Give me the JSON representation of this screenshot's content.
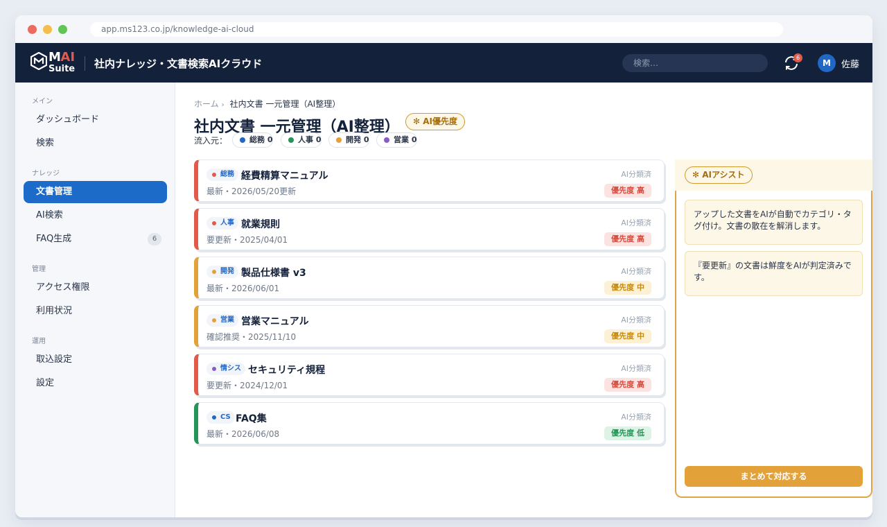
{
  "browser": {
    "url": "app.ms123.co.jp/knowledge-ai-cloud"
  },
  "header": {
    "logo_m": "M",
    "logo_ai": "AI",
    "logo_suite": "Suite",
    "title": "社内ナレッジ・文書検索AIクラウド",
    "search_placeholder": "検索…",
    "notification_count": "6",
    "avatar_initial": "M",
    "user_name": "佐藤"
  },
  "sidebar": {
    "groups": [
      {
        "label": "メイン",
        "items": [
          {
            "label": "ダッシュボード"
          },
          {
            "label": "検索"
          }
        ]
      },
      {
        "label": "ナレッジ",
        "items": [
          {
            "label": "文書管理",
            "active": true
          },
          {
            "label": "AI検索"
          },
          {
            "label": "FAQ生成",
            "count": "6"
          }
        ]
      },
      {
        "label": "管理",
        "items": [
          {
            "label": "アクセス権限"
          },
          {
            "label": "利用状況"
          }
        ]
      },
      {
        "label": "運用",
        "items": [
          {
            "label": "取込設定"
          },
          {
            "label": "設定"
          }
        ]
      }
    ]
  },
  "breadcrumb": {
    "home": "ホーム",
    "current": "社内文書 一元管理（AI整理）"
  },
  "page": {
    "title": "社内文書 一元管理（AI整理）",
    "ai_priority_label": "AI優先度",
    "source_label": "流入元：",
    "sources": [
      {
        "label": "総務 0",
        "color": "#2168c6"
      },
      {
        "label": "人事 0",
        "color": "#249457"
      },
      {
        "label": "開発 0",
        "color": "#e3a13a"
      },
      {
        "label": "営業 0",
        "color": "#8a5bc6"
      }
    ]
  },
  "documents": [
    {
      "dept": "総務",
      "dept_color": "#e25a4a",
      "name": "経費精算マニュアル",
      "meta": "最新・2026/05/20更新",
      "ai": "AI分類済",
      "priority": "優先度 高",
      "level": "high",
      "bar": "#e25a4a"
    },
    {
      "dept": "人事",
      "dept_color": "#e25a4a",
      "name": "就業規則",
      "meta": "要更新・2025/04/01",
      "ai": "AI分類済",
      "priority": "優先度 高",
      "level": "high",
      "bar": "#e25a4a"
    },
    {
      "dept": "開発",
      "dept_color": "#e3a13a",
      "name": "製品仕様書 v3",
      "meta": "最新・2026/06/01",
      "ai": "AI分類済",
      "priority": "優先度 中",
      "level": "mid",
      "bar": "#e3a13a"
    },
    {
      "dept": "営業",
      "dept_color": "#e3a13a",
      "name": "営業マニュアル",
      "meta": "確認推奨・2025/11/10",
      "ai": "AI分類済",
      "priority": "優先度 中",
      "level": "mid",
      "bar": "#e3a13a"
    },
    {
      "dept": "情シス",
      "dept_color": "#8a5bc6",
      "name": "セキュリティ規程",
      "meta": "要更新・2024/12/01",
      "ai": "AI分類済",
      "priority": "優先度 高",
      "level": "high",
      "bar": "#e25a4a"
    },
    {
      "dept": "CS",
      "dept_color": "#2168c6",
      "name": "FAQ集",
      "meta": "最新・2026/06/08",
      "ai": "AI分類済",
      "priority": "優先度 低",
      "level": "low",
      "bar": "#249457"
    }
  ],
  "assistant": {
    "title": "AIアシスト",
    "notes": [
      "アップした文書をAIが自動でカテゴリ・タグ付け。文書の散在を解消します。",
      "『要更新』の文書は鮮度をAIが判定済みです。"
    ],
    "action_label": "まとめて対応する"
  }
}
